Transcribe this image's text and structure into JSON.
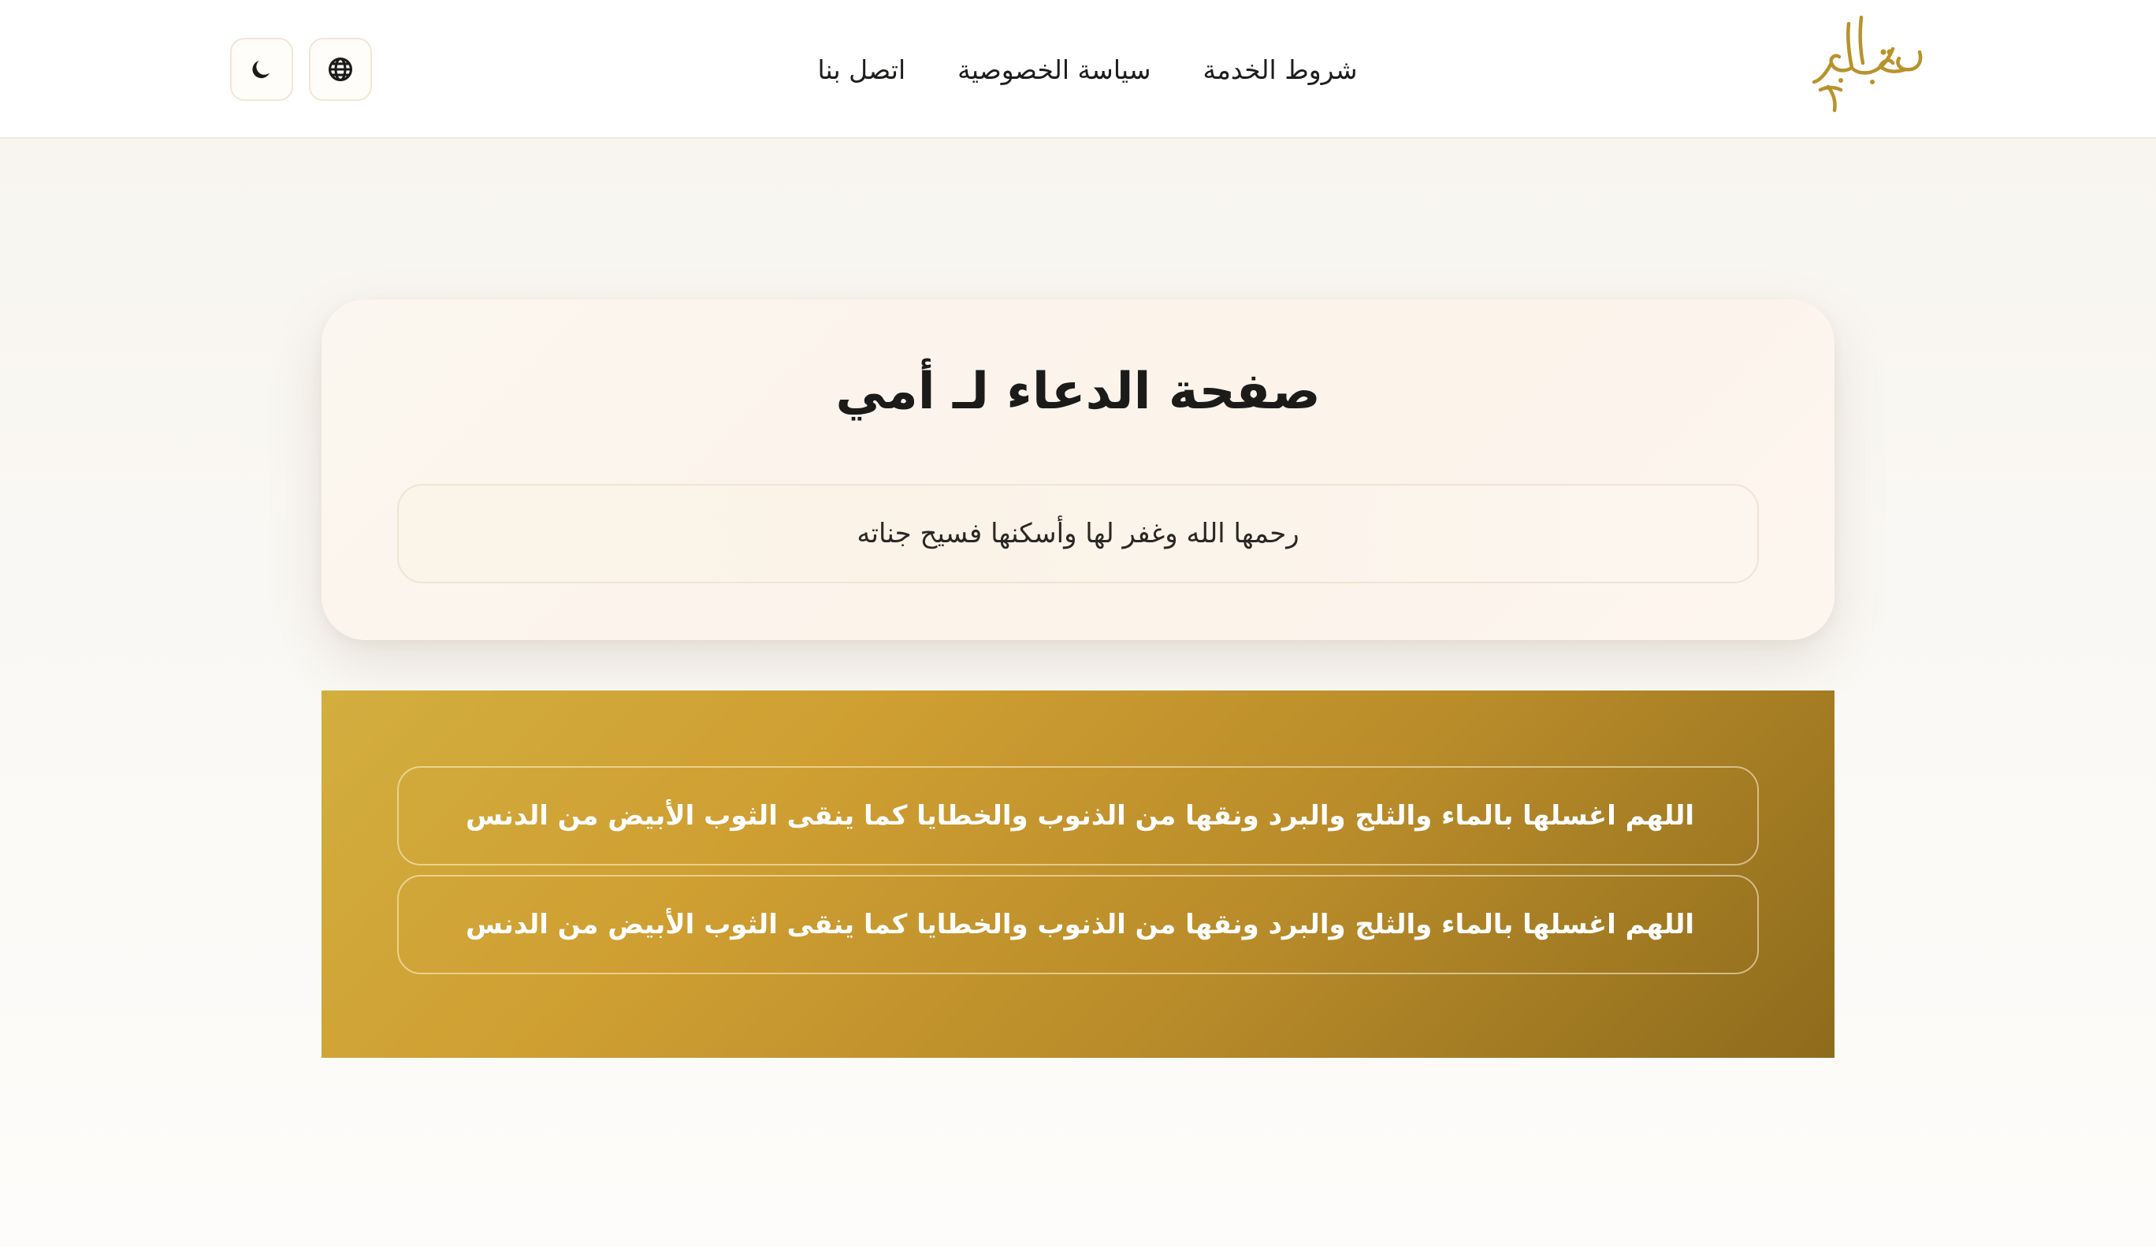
{
  "header": {
    "logo_text": "رحمة الهم",
    "nav": {
      "terms": "شروط الخدمة",
      "privacy": "سياسة الخصوصية",
      "contact": "اتصل بنا"
    },
    "language_icon": "globe-icon",
    "theme_icon": "moon-icon"
  },
  "main": {
    "title": "صفحة الدعاء لـ أمي",
    "subtitle": "رحمها الله وغفر لها وأسكنها فسيح جناته"
  },
  "duas": [
    "اللهم اغسلها بالماء والثلج والبرد ونقها من الذنوب والخطايا كما ينقى الثوب الأبيض من الدنس",
    "اللهم اغسلها بالماء والثلج والبرد ونقها من الذنوب والخطايا كما ينقى الثوب الأبيض من الدنس"
  ],
  "colors": {
    "accent_gold": "#b8922b",
    "gold_light": "#d2ae3f",
    "gold_dark": "#8e6b1c",
    "card_background": "#fcf5ec",
    "text_dark": "#1d1d1b"
  }
}
